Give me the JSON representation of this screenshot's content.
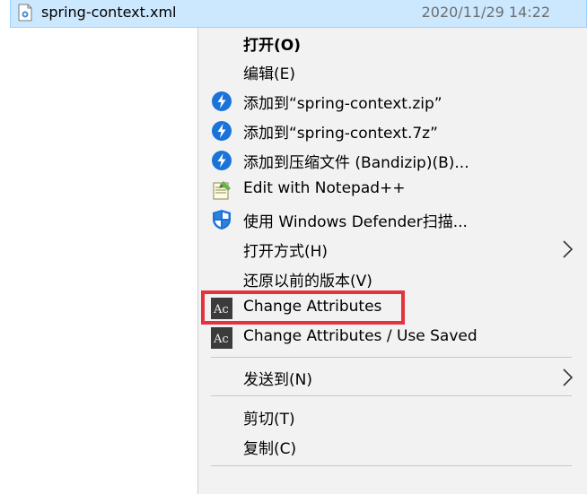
{
  "file": {
    "name": "spring-context.xml",
    "date": "2020/11/29 14:22"
  },
  "menu": {
    "items": [
      {
        "label": "打开(O)",
        "icon": "",
        "bold": true
      },
      {
        "label": "编辑(E)",
        "icon": ""
      },
      {
        "label": "添加到“spring-context.zip”",
        "icon": "bandizip-icon"
      },
      {
        "label": "添加到“spring-context.7z”",
        "icon": "bandizip-icon"
      },
      {
        "label": "添加到压缩文件 (Bandizip)(B)...",
        "icon": "bandizip-icon"
      },
      {
        "label": "Edit with Notepad++",
        "icon": "notepadpp-icon"
      },
      {
        "label": "使用 Windows Defender扫描...",
        "icon": "windows-defender-icon"
      },
      {
        "label": "打开方式(H)",
        "icon": "",
        "submenu": true
      },
      {
        "label": "还原以前的版本(V)",
        "icon": ""
      },
      {
        "label": "Change Attributes",
        "icon": "change-attributes-icon"
      },
      {
        "label": "Change Attributes / Use Saved",
        "icon": "change-attributes-icon"
      },
      {
        "label": "发送到(N)",
        "icon": "",
        "submenu": true
      },
      {
        "label": "剪切(T)",
        "icon": ""
      },
      {
        "label": "复制(C)",
        "icon": ""
      }
    ]
  },
  "colors": {
    "accent_blue": "#1a73d9",
    "highlight_red": "#e5323c",
    "selection": "#cce8ff"
  }
}
